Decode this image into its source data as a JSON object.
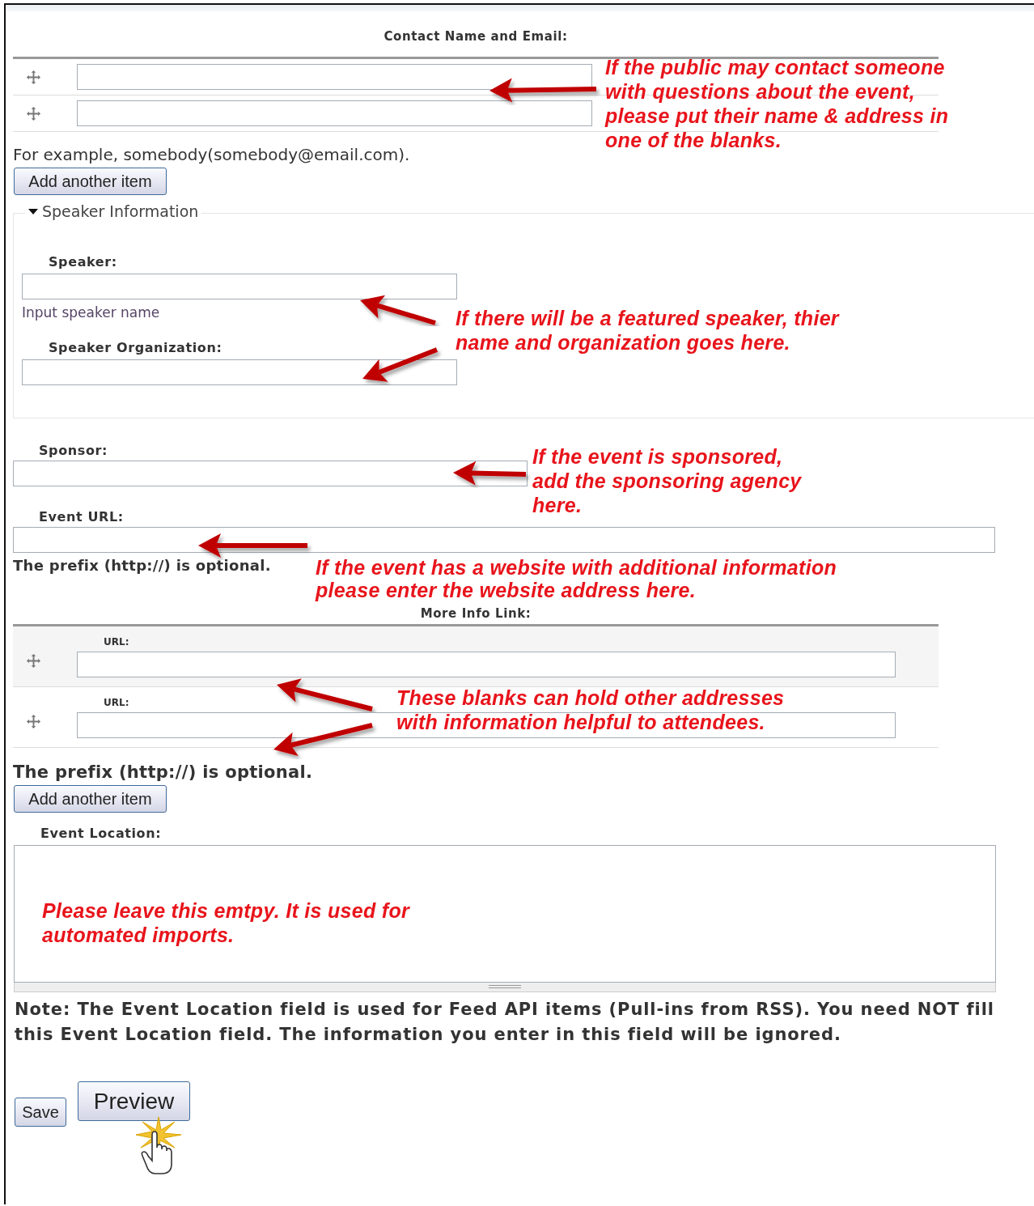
{
  "contact": {
    "label": "Contact Name and Email:",
    "rows": [
      {
        "draggable": true
      },
      {
        "draggable": true
      }
    ],
    "description": "For example, somebody(somebody@email.com).",
    "add_button": "Add another item"
  },
  "speaker_section": {
    "legend": "Speaker Information",
    "expanded": true,
    "fields": [
      {
        "label": "Speaker:",
        "description": "Input speaker name"
      },
      {
        "label": "Speaker Organization:"
      }
    ]
  },
  "sponsor": {
    "label": "Sponsor:"
  },
  "event_url": {
    "label": "Event URL:",
    "description": "The prefix (http://) is optional."
  },
  "more_info": {
    "label": "More Info Link:",
    "rows": [
      {
        "label": "URL:",
        "draggable": true
      },
      {
        "label": "URL:",
        "draggable": true
      }
    ],
    "description": "The prefix (http://) is optional.",
    "add_button": "Add another item"
  },
  "event_location": {
    "label": "Event Location:",
    "note": "Note: The Event Location field is used for Feed API items (Pull-ins from RSS). You need NOT fill this Event Location field. The information you enter in this field will be ignored."
  },
  "buttons": [
    {
      "label": "Save",
      "clicked": false
    },
    {
      "label": "Preview",
      "clicked": true
    }
  ],
  "annotations": [
    {
      "text": "If the public may contact someone with questions about the event, please put their name & address in one of the blanks."
    },
    {
      "text": "If there will be a featured speaker, thier name and organization goes here."
    },
    {
      "text": "If the event is sponsored, add the sponsoring agency here."
    },
    {
      "text": "If the event has a website with additional information please enter the website address here."
    },
    {
      "text": "These blanks can hold other addresses with information helpful to attendees."
    },
    {
      "text": "Please leave this emtpy. It is used for automated imports."
    }
  ]
}
